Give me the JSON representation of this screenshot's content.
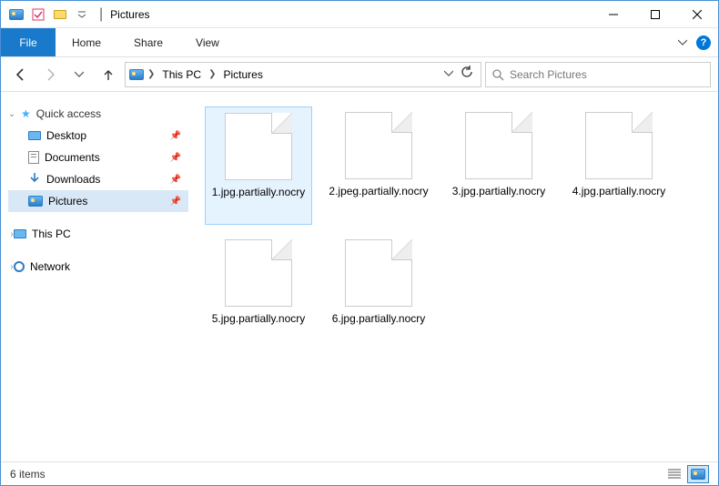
{
  "titlebar": {
    "title": "Pictures"
  },
  "ribbon": {
    "file": "File",
    "tabs": [
      "Home",
      "Share",
      "View"
    ]
  },
  "breadcrumb": {
    "items": [
      "This PC",
      "Pictures"
    ]
  },
  "search": {
    "placeholder": "Search Pictures"
  },
  "nav": {
    "quick_access": "Quick access",
    "items": [
      {
        "label": "Desktop",
        "pinned": true
      },
      {
        "label": "Documents",
        "pinned": true
      },
      {
        "label": "Downloads",
        "pinned": true
      },
      {
        "label": "Pictures",
        "pinned": true,
        "selected": true
      }
    ],
    "roots": [
      {
        "label": "This PC"
      },
      {
        "label": "Network"
      }
    ]
  },
  "files": [
    {
      "name": "1.jpg.partially.nocry",
      "selected": true
    },
    {
      "name": "2.jpeg.partially.nocry"
    },
    {
      "name": "3.jpg.partially.nocry"
    },
    {
      "name": "4.jpg.partially.nocry"
    },
    {
      "name": "5.jpg.partially.nocry"
    },
    {
      "name": "6.jpg.partially.nocry"
    }
  ],
  "statusbar": {
    "text": "6 items"
  }
}
